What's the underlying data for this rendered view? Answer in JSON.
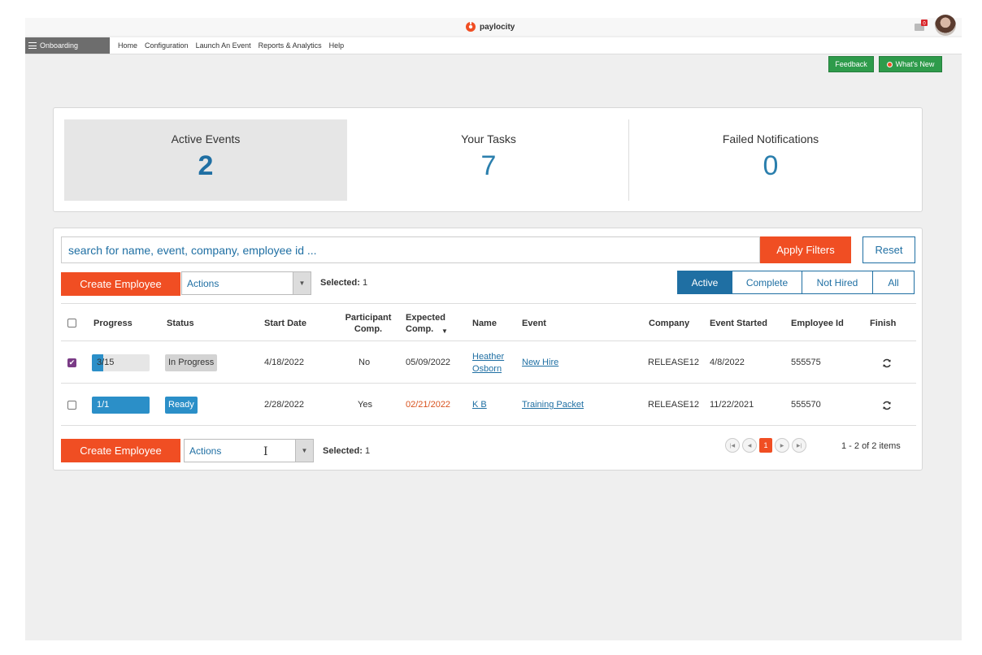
{
  "brand": {
    "name": "paylocity"
  },
  "nav": {
    "module": "Onboarding",
    "links": [
      "Home",
      "Configuration",
      "Launch An Event",
      "Reports & Analytics",
      "Help"
    ]
  },
  "topbuttons": {
    "feedback": "Feedback",
    "whats_new": "What's New"
  },
  "summary": {
    "active_events": {
      "label": "Active Events",
      "value": "2"
    },
    "your_tasks": {
      "label": "Your Tasks",
      "value": "7"
    },
    "failed_notifications": {
      "label": "Failed Notifications",
      "value": "0"
    }
  },
  "search": {
    "placeholder": "search for name, event, company, employee id ..."
  },
  "filters": {
    "apply": "Apply Filters",
    "reset": "Reset"
  },
  "toolbar": {
    "create": "Create Employee",
    "actions": "Actions",
    "selected_label": "Selected:",
    "selected_count": "1"
  },
  "status_tabs": [
    "Active",
    "Complete",
    "Not Hired",
    "All"
  ],
  "table": {
    "headers": {
      "progress": "Progress",
      "status": "Status",
      "start_date": "Start Date",
      "participant_comp": "Participant Comp.",
      "expected_comp": "Expected Comp.",
      "name": "Name",
      "event": "Event",
      "company": "Company",
      "event_started": "Event Started",
      "employee_id": "Employee Id",
      "finish": "Finish"
    },
    "rows": [
      {
        "checked": true,
        "progress_text": "3/15",
        "progress_fraction": 0.2,
        "status": "In Progress",
        "start_date": "4/18/2022",
        "participant_comp": "No",
        "expected_comp": "05/09/2022",
        "name_first": "Heather",
        "name_last": "Osborn",
        "event": "New Hire",
        "company": "RELEASE12",
        "event_started": "4/8/2022",
        "employee_id": "555575"
      },
      {
        "checked": false,
        "progress_text": "1/1",
        "progress_fraction": 1.0,
        "status": "Ready",
        "start_date": "2/28/2022",
        "participant_comp": "Yes",
        "expected_comp": "02/21/2022",
        "name_first": "K B",
        "name_last": "",
        "event": "Training Packet",
        "company": "RELEASE12",
        "event_started": "11/22/2021",
        "employee_id": "555570"
      }
    ]
  },
  "pager": {
    "current": "1",
    "info": "1 - 2 of 2 items"
  },
  "colors": {
    "accent": "#f04e23",
    "primary": "#1f6fa3",
    "green": "#2e9b4b"
  }
}
